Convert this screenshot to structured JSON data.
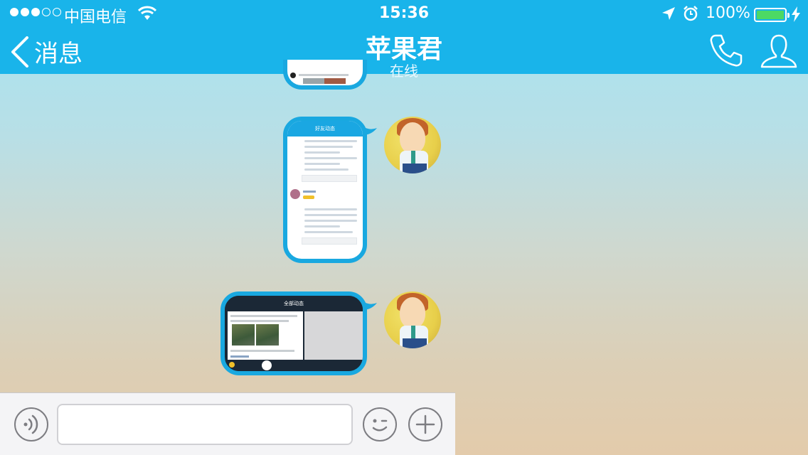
{
  "status_bar": {
    "carrier": "中国电信",
    "time": "15:36",
    "battery_pct": "100%",
    "signal_bars_filled": 3,
    "signal_bars_total": 5
  },
  "nav": {
    "back_label": "消息",
    "title": "苹果君",
    "subtitle": "在线"
  },
  "messages": [
    {
      "type": "image",
      "sender": "self",
      "screen_title": "好友动态"
    },
    {
      "type": "image",
      "sender": "self",
      "screen_title": "全部动态"
    }
  ],
  "input": {
    "placeholder": "",
    "value": ""
  },
  "colors": {
    "accent": "#19b4ea",
    "bubble_border": "#19a8e0",
    "battery_fill": "#4cd964"
  },
  "icons": {
    "back": "chevron-left-icon",
    "call": "phone-icon",
    "profile": "person-icon",
    "voice": "voice-icon",
    "emoji": "emoji-icon",
    "more": "plus-icon"
  }
}
